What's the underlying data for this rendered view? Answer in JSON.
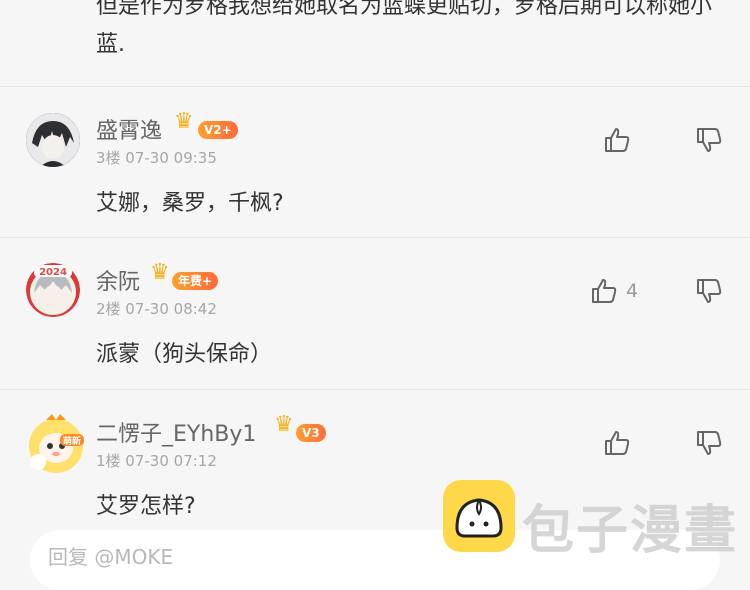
{
  "top_comment": {
    "text": "但是作为罗格我想给她取名为蓝蝶更贴切，罗格后期可以称她小蓝."
  },
  "comments": [
    {
      "username": "盛霄逸",
      "badge": "V2+",
      "meta": "3楼 07-30 09:35",
      "text": "艾娜，桑罗，千枫?",
      "likes": ""
    },
    {
      "username": "余阮",
      "badge": "年费+",
      "meta": "2楼 07-30 08:42",
      "text": "派蒙（狗头保命）",
      "likes": "4"
    },
    {
      "username": "二愣子_EYhBy1",
      "badge": "V3",
      "meta": "1楼 07-30 07:12",
      "text": "艾罗怎样?",
      "likes": ""
    }
  ],
  "reply": {
    "placeholder": "回复 @MOKE"
  },
  "watermark": {
    "text": "包子漫畫"
  },
  "icons": {
    "like": "thumb-up-icon",
    "dislike": "thumb-down-icon",
    "crown": "crown-icon"
  },
  "colors": {
    "crown": "#f2b21b",
    "badge": "#ff7a3a",
    "watermark_icon": "#ffd84a"
  }
}
